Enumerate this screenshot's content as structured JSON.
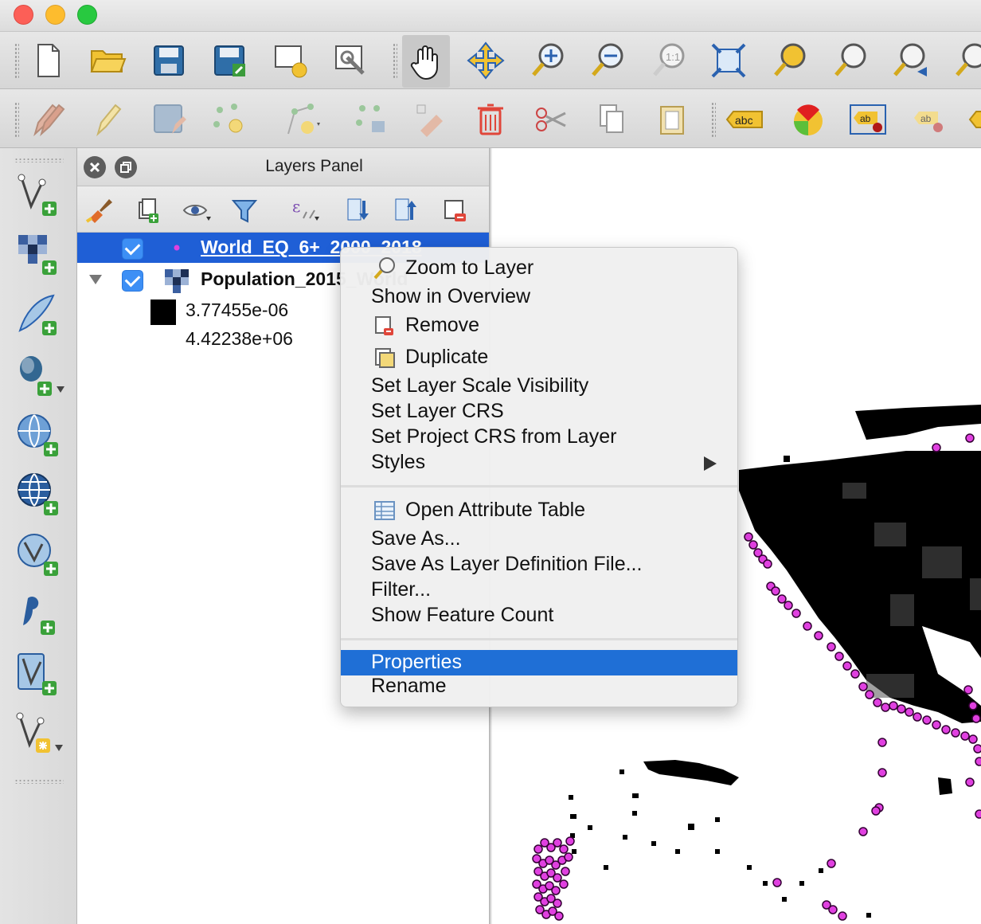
{
  "window": {
    "title_lights": [
      "close",
      "minimize",
      "zoom"
    ]
  },
  "layers_panel": {
    "title": "Layers Panel",
    "layers": [
      {
        "name": "World_EQ_6+_2000_2018",
        "checked": true,
        "selected": true,
        "symbol_color": "#e040e0"
      },
      {
        "name": "Population_2015_World",
        "checked": true,
        "selected": false,
        "expanded": true
      }
    ],
    "legend": {
      "min": "3.77455e-06",
      "max": "4.42238e+06"
    }
  },
  "context_menu": {
    "items": [
      {
        "label": "Zoom to Layer",
        "icon": "zoom-layer-icon"
      },
      {
        "label": "Show in Overview"
      },
      {
        "label": "Remove",
        "icon": "remove-layer-icon"
      },
      {
        "label": "Duplicate",
        "icon": "duplicate-layer-icon"
      },
      {
        "label": "Set Layer Scale Visibility"
      },
      {
        "label": "Set Layer CRS"
      },
      {
        "label": "Set Project CRS from Layer"
      },
      {
        "label": "Styles",
        "submenu": true
      }
    ],
    "items2": [
      {
        "label": "Open Attribute Table",
        "icon": "attribute-table-icon"
      },
      {
        "label": "Save As..."
      },
      {
        "label": "Save As Layer Definition File..."
      },
      {
        "label": "Filter..."
      },
      {
        "label": "Show Feature Count"
      }
    ],
    "items3": [
      {
        "label": "Properties",
        "highlighted": true
      },
      {
        "label": "Rename"
      }
    ]
  },
  "map": {
    "earthquake_color": "#e040e0",
    "population_color": "#000000"
  }
}
